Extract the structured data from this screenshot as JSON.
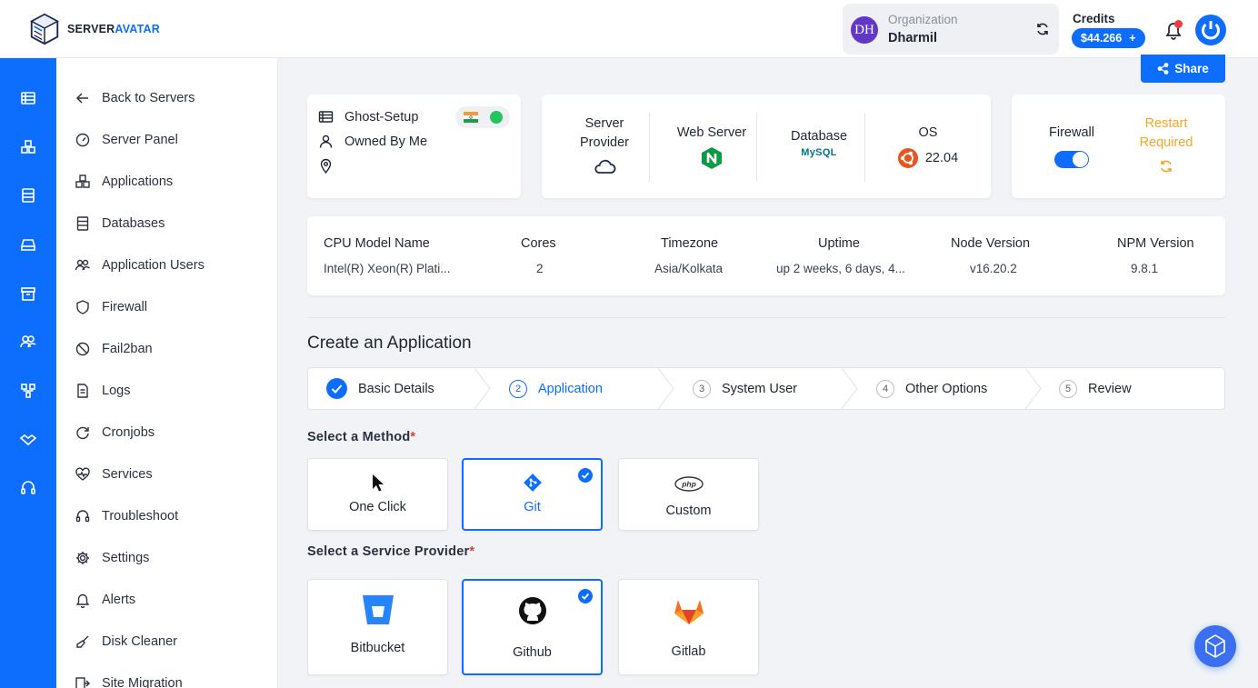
{
  "brand": {
    "name_part1": "SERVER",
    "name_part2": "AVATAR"
  },
  "org": {
    "initials": "DH",
    "label": "Organization",
    "name": "Dharmil"
  },
  "credits": {
    "label": "Credits",
    "amount": "$44.266",
    "plus": "+"
  },
  "share_label": "Share",
  "sidebar": {
    "items": [
      {
        "label": "Back to Servers",
        "icon": "arrow-left-icon"
      },
      {
        "label": "Server Panel",
        "icon": "gauge-icon"
      },
      {
        "label": "Applications",
        "icon": "cubes-icon"
      },
      {
        "label": "Databases",
        "icon": "database-icon"
      },
      {
        "label": "Application Users",
        "icon": "users-icon"
      },
      {
        "label": "Firewall",
        "icon": "shield-icon"
      },
      {
        "label": "Fail2ban",
        "icon": "ban-icon"
      },
      {
        "label": "Logs",
        "icon": "file-icon"
      },
      {
        "label": "Cronjobs",
        "icon": "refresh-icon"
      },
      {
        "label": "Services",
        "icon": "heartbeat-icon"
      },
      {
        "label": "Troubleshoot",
        "icon": "headset-icon"
      },
      {
        "label": "Settings",
        "icon": "gear-icon"
      },
      {
        "label": "Alerts",
        "icon": "bell-icon"
      },
      {
        "label": "Disk Cleaner",
        "icon": "broom-icon"
      },
      {
        "label": "Site Migration",
        "icon": "migrate-icon"
      }
    ]
  },
  "server": {
    "name": "Ghost-Setup",
    "owner": "Owned By Me",
    "status_color": "#22c55e"
  },
  "info": {
    "provider_label": "Server Provider",
    "webserver_label": "Web Server",
    "database_label": "Database",
    "database_value": "MySQL",
    "os_label": "OS",
    "os_version": "22.04"
  },
  "firewall": {
    "label": "Firewall",
    "enabled": true,
    "restart_line1": "Restart",
    "restart_line2": "Required"
  },
  "specs": {
    "cpu_label": "CPU Model Name",
    "cpu_value": "Intel(R) Xeon(R) Plati...",
    "cores_label": "Cores",
    "cores_value": "2",
    "tz_label": "Timezone",
    "tz_value": "Asia/Kolkata",
    "uptime_label": "Uptime",
    "uptime_value": "up 2 weeks, 6 days, 4...",
    "node_label": "Node Version",
    "node_value": "v16.20.2",
    "npm_label": "NPM Version",
    "npm_value": "9.8.1"
  },
  "create": {
    "title": "Create an Application",
    "steps": [
      {
        "num": "1",
        "label": "Basic Details",
        "state": "done"
      },
      {
        "num": "2",
        "label": "Application",
        "state": "active"
      },
      {
        "num": "3",
        "label": "System User",
        "state": "pending"
      },
      {
        "num": "4",
        "label": "Other Options",
        "state": "pending"
      },
      {
        "num": "5",
        "label": "Review",
        "state": "pending"
      }
    ],
    "method_label": "Select a Method",
    "methods": [
      {
        "label": "One Click",
        "selected": false
      },
      {
        "label": "Git",
        "selected": true
      },
      {
        "label": "Custom",
        "selected": false
      }
    ],
    "provider_label": "Select a Service Provider",
    "providers": [
      {
        "label": "Bitbucket",
        "selected": false
      },
      {
        "label": "Github",
        "selected": true
      },
      {
        "label": "Gitlab",
        "selected": false
      }
    ],
    "required_mark": "*"
  },
  "colors": {
    "accent": "#0d6efd",
    "warning": "#f5a623",
    "danger": "#ef3b3b"
  }
}
